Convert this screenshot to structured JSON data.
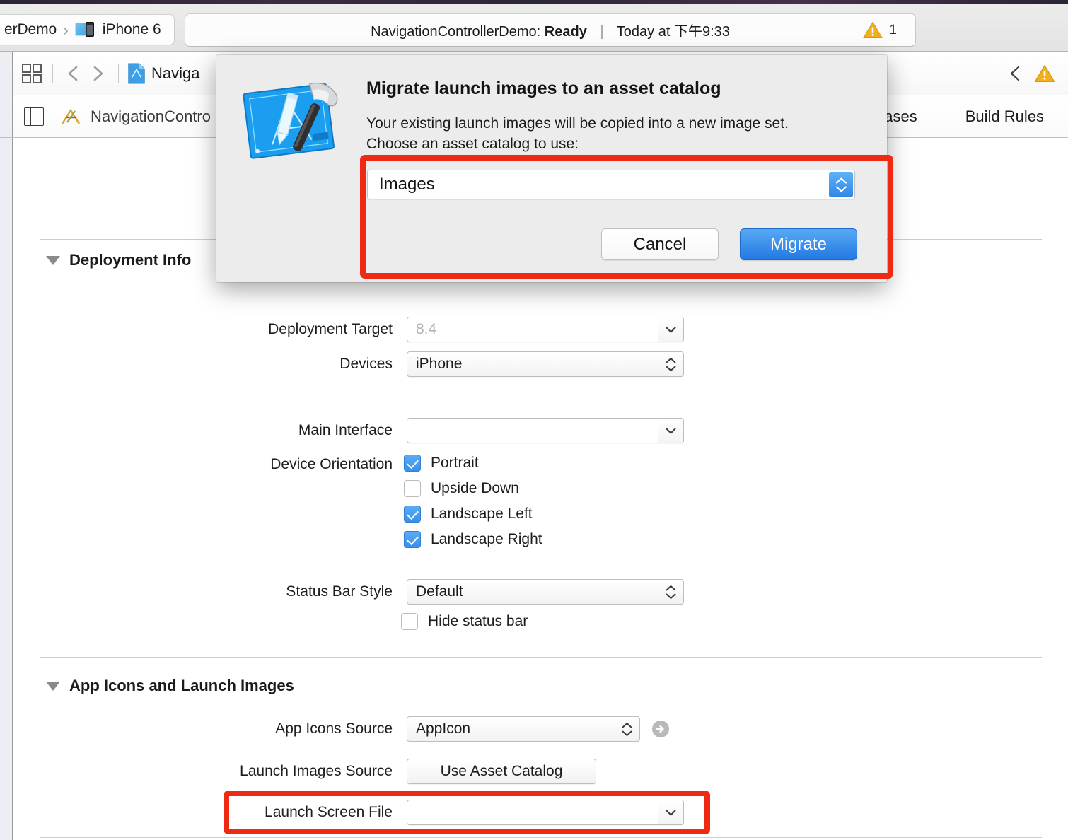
{
  "toolbar": {
    "scheme_project": "erDemo",
    "scheme_separator": "›",
    "scheme_destination": "iPhone 6",
    "device_icon": "iphone-simulator-icon",
    "status_prefix": "NavigationControllerDemo:",
    "status_state": "Ready",
    "status_divider": "|",
    "status_time": "Today at 下午9:33",
    "warning_icon": "warning-triangle-icon",
    "warning_count": "1"
  },
  "jumpbar": {
    "grid_icon": "related-items-icon",
    "back_icon": "chevron-left-icon",
    "forward_icon": "chevron-right-icon",
    "file_icon": "project-file-icon",
    "path_title": "Naviga",
    "collapse_icon": "chevron-left-icon",
    "warning_icon": "warning-triangle-icon"
  },
  "targetbar": {
    "pane_toggle_icon": "navigator-toggle-icon",
    "target_icon": "xcode-project-icon",
    "target_name": "NavigationContro",
    "tabs": [
      {
        "label": "hases"
      },
      {
        "label": "Build Rules"
      }
    ]
  },
  "sections": {
    "deployment_info": {
      "disclosure_icon": "disclosure-triangle-open-icon",
      "title": "Deployment Info",
      "rows": {
        "deployment_target": {
          "label": "Deployment Target",
          "value": "8.4",
          "placeholder": "8.4",
          "control": "combo-box",
          "arrow_icon": "chevron-down-icon"
        },
        "devices": {
          "label": "Devices",
          "value": "iPhone",
          "control": "popup-button",
          "arrow_icon": "chevron-up-down-icon"
        },
        "main_interface": {
          "label": "Main Interface",
          "value": "",
          "control": "combo-box",
          "arrow_icon": "chevron-down-icon"
        },
        "device_orientation": {
          "label": "Device Orientation",
          "options": [
            {
              "label": "Portrait",
              "checked": true
            },
            {
              "label": "Upside Down",
              "checked": false
            },
            {
              "label": "Landscape Left",
              "checked": true
            },
            {
              "label": "Landscape Right",
              "checked": true
            }
          ]
        },
        "status_bar_style": {
          "label": "Status Bar Style",
          "value": "Default",
          "control": "popup-button",
          "arrow_icon": "chevron-up-down-icon"
        },
        "hide_status_bar": {
          "label": "Hide status bar",
          "checked": false
        }
      }
    },
    "app_icons_launch_images": {
      "disclosure_icon": "disclosure-triangle-open-icon",
      "title": "App Icons and Launch Images",
      "rows": {
        "app_icons_source": {
          "label": "App Icons Source",
          "value": "AppIcon",
          "control": "popup-button",
          "arrow_icon": "chevron-up-down-icon",
          "go_icon": "arrow-right-circle-icon"
        },
        "launch_images_source": {
          "label": "Launch Images Source",
          "button_label": "Use Asset Catalog"
        },
        "launch_screen_file": {
          "label": "Launch Screen File",
          "value": "",
          "control": "combo-box",
          "arrow_icon": "chevron-down-icon"
        }
      }
    }
  },
  "dialog": {
    "icon": "xcode-hammer-blueprint-icon",
    "title": "Migrate launch images to an asset catalog",
    "message": "Your existing launch images will be copied into a new image set. Choose an asset catalog to use:",
    "catalog_popup": {
      "value": "Images",
      "control": "popup-button",
      "arrow_icon": "chevron-up-down-icon"
    },
    "cancel_label": "Cancel",
    "migrate_label": "Migrate"
  },
  "annotations": {
    "highlight_color": "#ee2a14",
    "boxes": [
      {
        "name": "asset-catalog-choice-highlight"
      },
      {
        "name": "launch-screen-file-highlight"
      }
    ]
  },
  "colors": {
    "accent_blue": "#2279e2",
    "warning_yellow": "#f5b320",
    "checkbox_blue": "#3b8fe8",
    "highlight_red": "#ee2a14"
  }
}
